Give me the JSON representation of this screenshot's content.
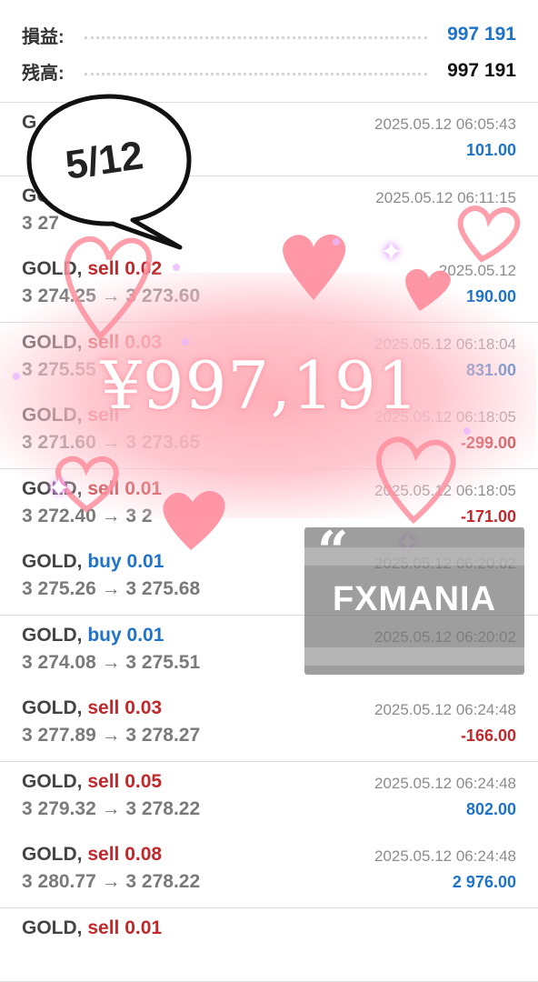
{
  "summary": {
    "pl_label": "損益:",
    "pl_value": "997 191",
    "balance_label": "残高:",
    "balance_value": "997 191"
  },
  "deals": [
    {
      "symbol": "G",
      "direction": "",
      "volume": "",
      "prices": "",
      "time": "2025.05.12 06:05:43",
      "profit": "101.00",
      "profit_sign": "pos"
    },
    {
      "symbol": "GOLD",
      "direction": "",
      "volume": "",
      "prices": "3 27",
      "time": "2025.05.12 06:11:15",
      "profit": "",
      "profit_sign": "pos"
    },
    {
      "symbol": "GOLD,",
      "direction": "sell",
      "volume": "0.02",
      "prices": "3 274.25 → 3 273.60",
      "time": "2025.05.12",
      "profit": "190.00",
      "profit_sign": "pos"
    },
    {
      "symbol": "GOLD,",
      "direction": "sell",
      "volume": "0.03",
      "prices": "3 275.55",
      "time": "2025.05.12 06:18:04",
      "profit": "831.00",
      "profit_sign": "pos"
    },
    {
      "symbol": "GOLD,",
      "direction": "sell",
      "volume": "",
      "prices": "3 271.60 → 3 273.65",
      "time": "2025.05.12 06:18:05",
      "profit": "-299.00",
      "profit_sign": "neg"
    },
    {
      "symbol": "GOLD,",
      "direction": "sell",
      "volume": "0.01",
      "prices": "3 272.40 → 3 2",
      "time": "2025.05.12 06:18:05",
      "profit": "-171.00",
      "profit_sign": "neg"
    },
    {
      "symbol": "GOLD,",
      "direction": "buy",
      "volume": "0.01",
      "prices": "3 275.26 → 3 275.68",
      "time": "2025.05.12 06:20:02",
      "profit": "",
      "profit_sign": "pos"
    },
    {
      "symbol": "GOLD,",
      "direction": "buy",
      "volume": "0.01",
      "prices": "3 274.08 → 3 275.51",
      "time": "2025.05.12 06:20:02",
      "profit": "",
      "profit_sign": "pos"
    },
    {
      "symbol": "GOLD,",
      "direction": "sell",
      "volume": "0.03",
      "prices": "3 277.89 → 3 278.27",
      "time": "2025.05.12 06:24:48",
      "profit": "-166.00",
      "profit_sign": "neg"
    },
    {
      "symbol": "GOLD,",
      "direction": "sell",
      "volume": "0.05",
      "prices": "3 279.32 → 3 278.22",
      "time": "2025.05.12 06:24:48",
      "profit": "802.00",
      "profit_sign": "pos"
    },
    {
      "symbol": "GOLD,",
      "direction": "sell",
      "volume": "0.08",
      "prices": "3 280.77 → 3 278.22",
      "time": "2025.05.12 06:24:48",
      "profit": "2 976.00",
      "profit_sign": "pos"
    },
    {
      "symbol": "GOLD,",
      "direction": "sell",
      "volume": "0.01",
      "prices": "",
      "time": "",
      "profit": "",
      "profit_sign": "pos"
    }
  ],
  "overlay": {
    "bubble_date": "5/12",
    "big_amount": "¥997,191",
    "watermark_quote": "“",
    "watermark_text": "FXMANIA"
  },
  "colors": {
    "sell": "#c0282c",
    "buy": "#1e73c8",
    "profit_positive": "#1e73c8",
    "profit_negative": "#c0282c",
    "heart": "#ff8e9e"
  }
}
